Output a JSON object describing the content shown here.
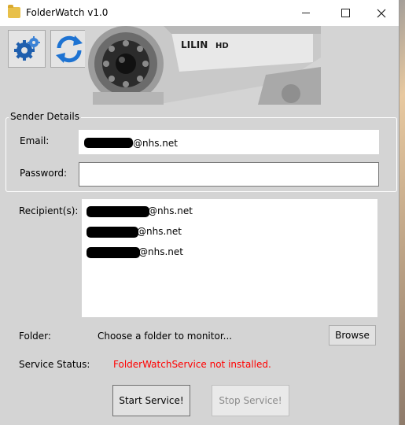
{
  "window": {
    "title": "FolderWatch v1.0",
    "minimize_icon": "minimize-icon",
    "maximize_icon": "maximize-icon",
    "close_icon": "close-icon"
  },
  "toolbar": {
    "settings_icon": "gears-icon",
    "refresh_icon": "refresh-arrows-icon",
    "banner_icon": "cctv-camera-banner",
    "banner_brand": "LILIN",
    "banner_badge": "HD"
  },
  "sender": {
    "group_label": "Sender Details",
    "email_label": "Email:",
    "email_value": "@nhs.net",
    "password_label": "Password:",
    "password_value": ""
  },
  "recipients": {
    "label": "Recipient(s):",
    "items": [
      {
        "domain": "@nhs.net"
      },
      {
        "domain": "@nhs.net"
      },
      {
        "domain": "@nhs.net"
      }
    ]
  },
  "folder": {
    "label": "Folder:",
    "hint": "Choose a folder to monitor...",
    "browse_label": "Browse"
  },
  "service": {
    "status_label": "Service Status:",
    "status_text": "FolderWatchService not installed.",
    "status_color": "#ff0000",
    "start_label": "Start Service!",
    "stop_label": "Stop Service!"
  }
}
